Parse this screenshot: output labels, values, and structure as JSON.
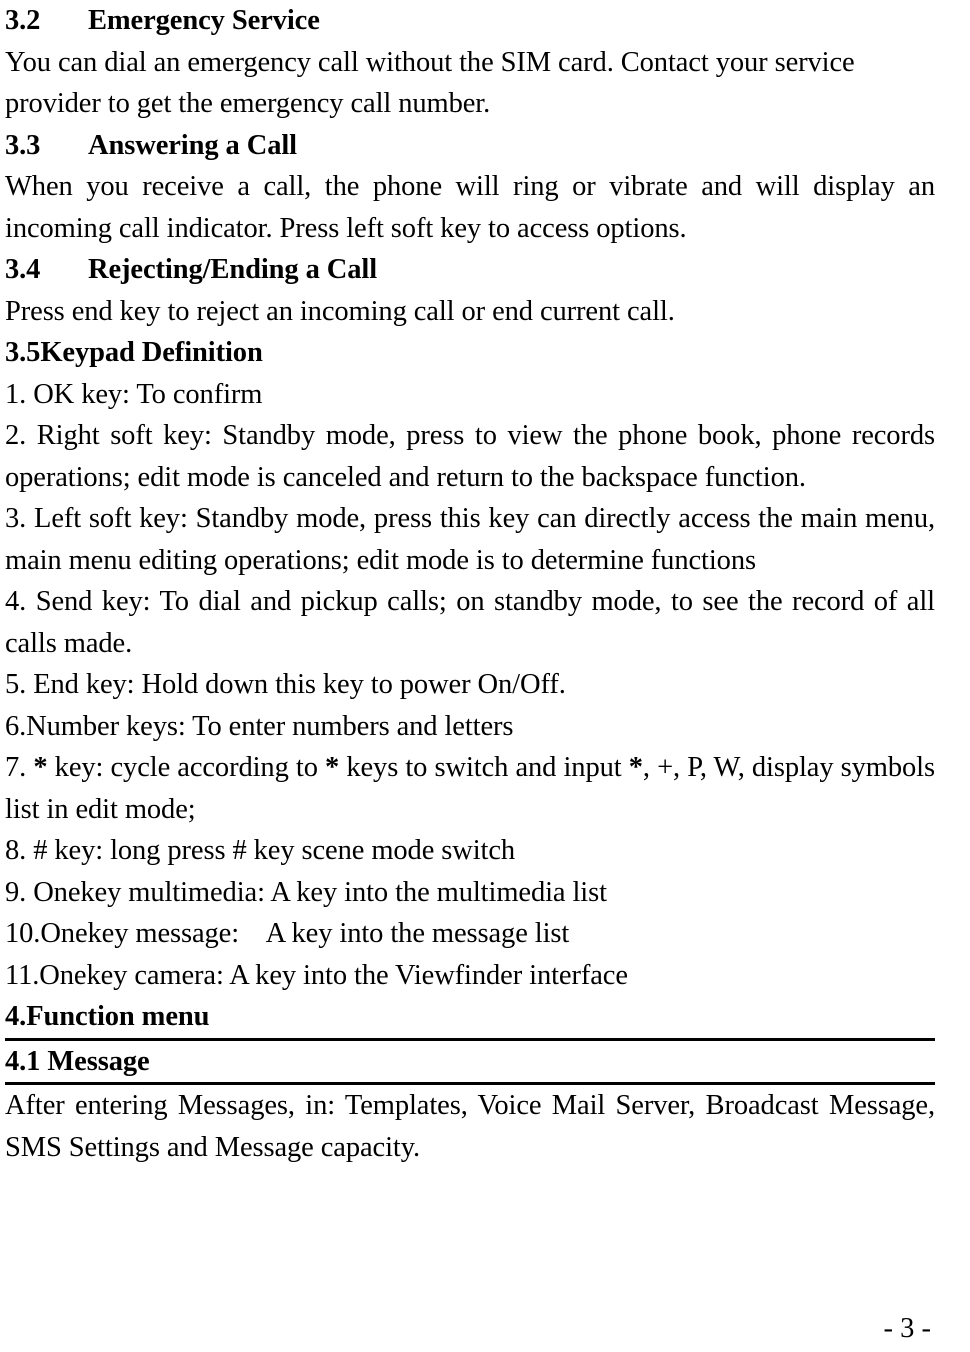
{
  "page": {
    "number_label": "- 3 -"
  },
  "sections": {
    "s32": {
      "number": "3.2",
      "title": "Emergency Service",
      "body": "You can dial an emergency call without the SIM card. Contact your service provider to get the emergency call number."
    },
    "s33": {
      "number": "3.3",
      "title": "Answering a Call",
      "body": "When you receive a call, the phone will ring or vibrate and will display an incoming call indicator. Press left soft key to access options."
    },
    "s34": {
      "number": "3.4",
      "title": "Rejecting/Ending a Call",
      "body": "Press end key to reject an incoming call or end current call."
    },
    "s35": {
      "number": "3.5",
      "title": "Keypad Definition"
    },
    "s4": {
      "number": "4.",
      "title": "Function menu"
    },
    "s41": {
      "number": "4.1",
      "title": "Message",
      "body": "After entering Messages, in: Templates, Voice Mail Server, Broadcast Message, SMS Settings and Message capacity."
    }
  },
  "keypad_items": {
    "item1": "1. OK key: To confirm",
    "item2": "2. Right soft key: Standby mode, press to view the phone book, phone records operations; edit mode is canceled and return to the backspace function.",
    "item3": "3. Left soft key: Standby mode, press this key can directly access the main menu, main menu editing operations; edit mode is to determine functions",
    "item4": "4. Send key: To dial and pickup calls; on standby mode, to see the record of all calls made.",
    "item5": "5. End key: Hold down this key to power On/Off.",
    "item6": "6.Number keys: To enter numbers and letters",
    "item7_a": "7. ",
    "item7_star1": "*",
    "item7_b": " key: cycle according to ",
    "item7_star2": "*",
    "item7_c": " keys to switch and input ",
    "item7_star3": "*",
    "item7_d": ", +, P, W, display symbols list in edit mode;",
    "item8": "8. # key: long press # key scene mode switch",
    "item9": "9. Onekey multimedia: A key into the multimedia list",
    "item10": "10.Onekey message:    A key into the message list",
    "item11": "11.Onekey camera: A key into the Viewfinder interface"
  }
}
